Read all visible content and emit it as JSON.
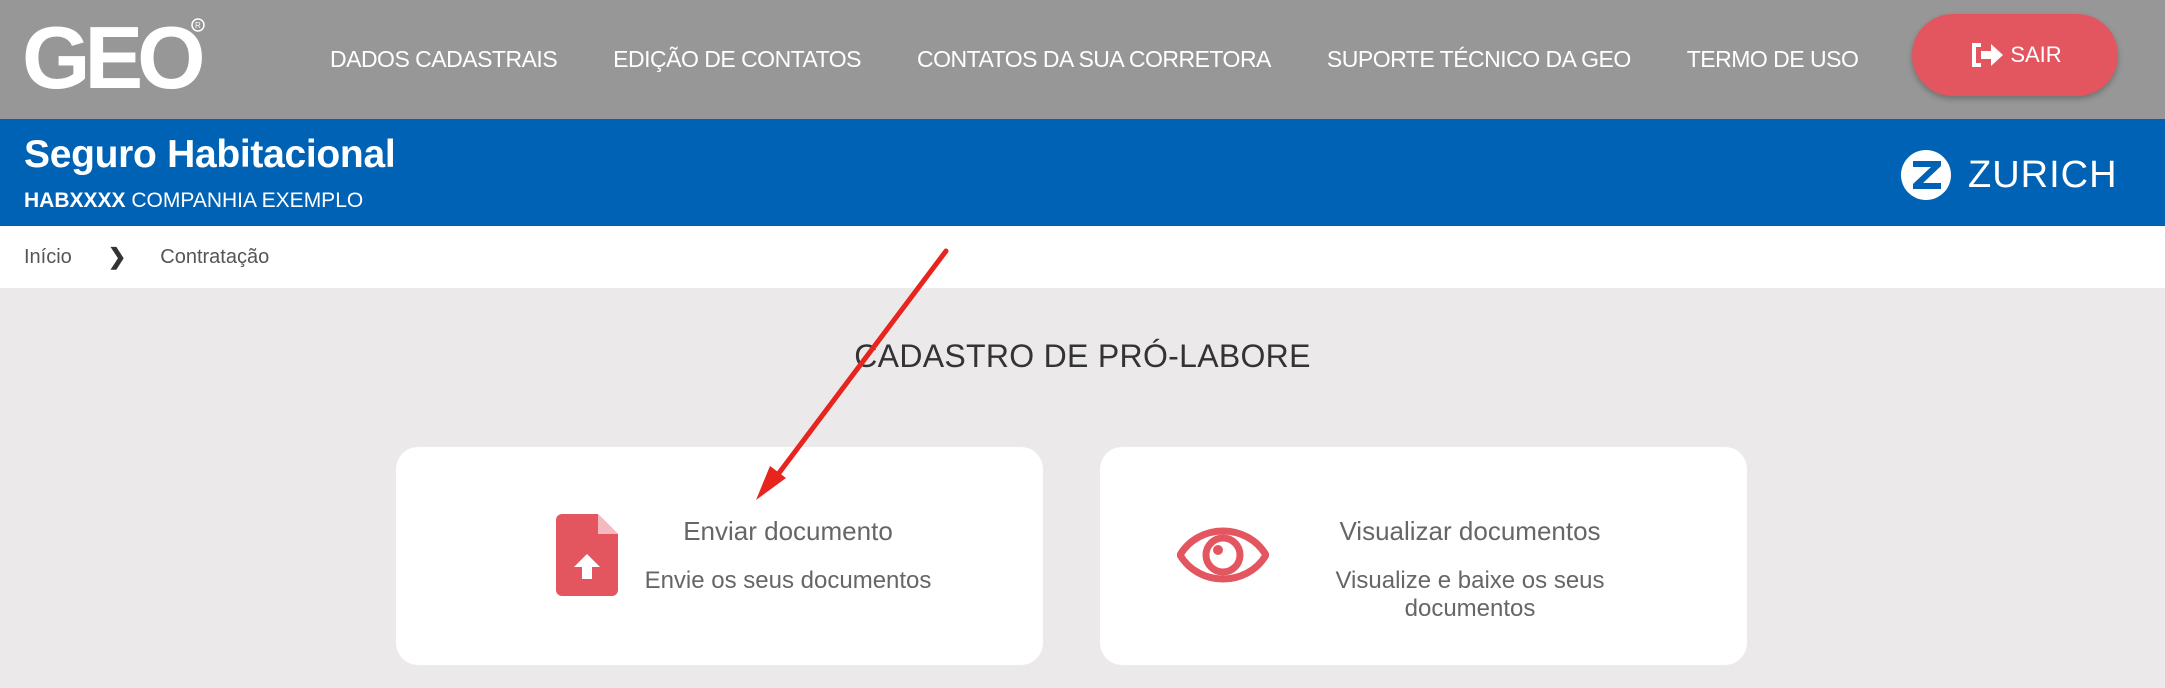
{
  "brand": {
    "logo_text": "GEO"
  },
  "nav": {
    "items": [
      "DADOS CADASTRAIS",
      "EDIÇÃO DE CONTATOS",
      "CONTATOS DA SUA CORRETORA",
      "SUPORTE TÉCNICO DA GEO",
      "TERMO DE USO"
    ],
    "logout_label": "SAIR"
  },
  "product": {
    "title": "Seguro Habitacional",
    "code": "HABXXXX",
    "company": "COMPANHIA EXEMPLO",
    "insurer": "ZURICH"
  },
  "breadcrumb": {
    "home": "Início",
    "current": "Contratação"
  },
  "page": {
    "title": "CADASTRO DE PRÓ-LABORE",
    "cards": [
      {
        "title": "Enviar documento",
        "description": "Envie os seus documentos",
        "icon": "file-upload-icon"
      },
      {
        "title": "Visualizar documentos",
        "description": "Visualize e baixe os seus documentos",
        "icon": "eye-icon"
      }
    ]
  },
  "colors": {
    "topbar": "#979797",
    "product_bar": "#0062b4",
    "accent_red": "#e35660",
    "background": "#ebe9e9"
  }
}
